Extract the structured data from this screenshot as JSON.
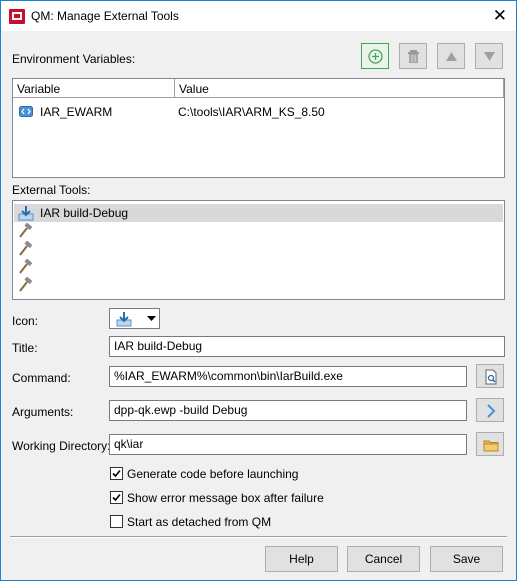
{
  "window": {
    "title": "QM: Manage External Tools",
    "close_glyph": "✕"
  },
  "env": {
    "label": "Environment Variables:",
    "toolbar": [
      "add-icon",
      "delete-icon",
      "move-up-icon",
      "move-down-icon"
    ],
    "columns": [
      "Variable",
      "Value"
    ],
    "rows": [
      {
        "variable": "IAR_EWARM",
        "value": "C:\\tools\\IAR\\ARM_KS_8.50"
      }
    ]
  },
  "tools": {
    "label": "External Tools:",
    "items": [
      {
        "title": "IAR build-Debug",
        "icon": "iar-build-icon",
        "selected": true
      },
      {
        "title": "",
        "icon": "hammer-icon",
        "selected": false
      },
      {
        "title": "",
        "icon": "hammer-icon",
        "selected": false
      },
      {
        "title": "",
        "icon": "hammer-icon",
        "selected": false
      },
      {
        "title": "",
        "icon": "hammer-icon",
        "selected": false
      }
    ]
  },
  "form": {
    "icon_label": "Icon:",
    "title_label": "Title:",
    "title_value": "IAR build-Debug",
    "command_label": "Command:",
    "command_value": "%IAR_EWARM%\\common\\bin\\IarBuild.exe",
    "arguments_label": "Arguments:",
    "arguments_value": "dpp-qk.ewp -build Debug",
    "workdir_label": "Working Directory:",
    "workdir_value": "qk\\iar"
  },
  "options": [
    {
      "label": "Generate code before launching",
      "checked": true
    },
    {
      "label": "Show error message box after failure",
      "checked": true
    },
    {
      "label": "Start as detached from QM",
      "checked": false
    }
  ],
  "buttons": {
    "help": "Help",
    "cancel": "Cancel",
    "save": "Save"
  },
  "colors": {
    "accent_border": "#1883d7",
    "selection": "#d9d9d9",
    "add_green": "#4aa35a"
  }
}
